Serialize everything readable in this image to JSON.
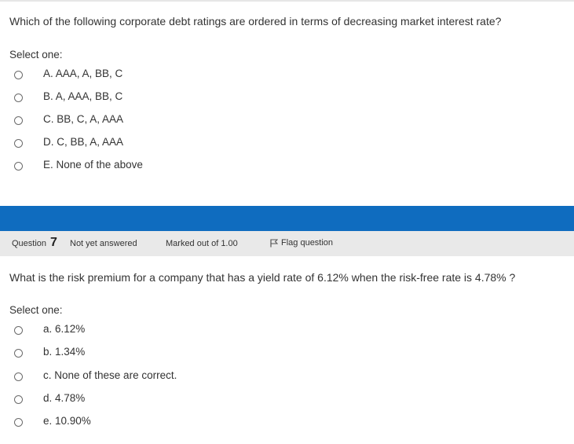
{
  "question6": {
    "text": "Which of the following corporate debt ratings are ordered in terms of decreasing market interest rate?",
    "select_label": "Select one:",
    "options": [
      "A. AAA, A, BB, C",
      "B. A, AAA, BB, C",
      "C. BB, C, A, AAA",
      "D. C, BB, A, AAA",
      "E. None of the above"
    ]
  },
  "question7": {
    "label": "Question",
    "number": "7",
    "status": "Not yet answered",
    "marks": "Marked out of 1.00",
    "flag_label": "Flag question",
    "text": "What is the risk premium for a company that has a yield rate of 6.12% when the risk-free rate is 4.78% ?",
    "select_label": "Select one:",
    "options": [
      "a. 6.12%",
      "b. 1.34%",
      "c. None of these are correct.",
      "d. 4.78%",
      "e. 10.90%"
    ]
  },
  "colors": {
    "accent": "#0f6cbf",
    "info_bar": "#e9e9e9"
  }
}
